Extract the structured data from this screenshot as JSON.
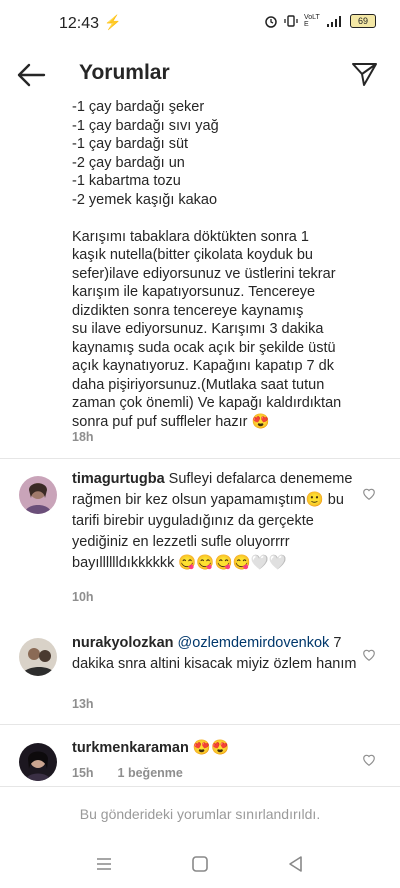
{
  "status": {
    "time": "12:43",
    "sys_icon": "⚡",
    "icons": [
      "alarm-icon",
      "vibrate-icon",
      "volte-icon",
      "signal-icon"
    ],
    "volte": "VoLTE",
    "battery": "69"
  },
  "header": {
    "title": "Yorumlar"
  },
  "caption": {
    "lines": [
      "-1 çay bardağı şeker",
      "-1 çay bardağı sıvı yağ",
      "-1 çay bardağı süt",
      "-2 çay bardağı un",
      "-1 kabartma tozu",
      "-2 yemek kaşığı kakao"
    ],
    "paragraph": [
      "Karışımı tabaklara döktükten sonra 1",
      "kaşık nutella(bitter çikolata koyduk bu",
      "sefer)ilave ediyorsunuz ve üstlerini tekrar",
      "karışım ile kapatıyorsunuz. Tencereye",
      "dizdikten sonra tencereye kaynamış",
      "su ilave ediyorsunuz. Karışımı 3 dakika",
      "kaynamış suda ocak açık bir şekilde üstü",
      "açık kaynatıyoruz. Kapağını kapatıp 7 dk",
      "daha pişiriyorsunuz.(Mutlaka saat tutun",
      "zaman çok önemli) Ve kapağı kaldırdıktan",
      "sonra puf puf suffleler hazır 😍"
    ],
    "time": "18h"
  },
  "comments": [
    {
      "username": "timagurtugba",
      "text": " Sufleyi defalarca denememe rağmen bir kez olsun yapamamıştım🙂 bu tarifi birebir uyguladığınız da gerçekte yediğiniz en lezzetli sufle oluyorrrr bayılllllldıkkkkkk 😋😋😋😋🤍🤍",
      "time": "10h",
      "likes": ""
    },
    {
      "username": "nurakyolozkan",
      "mention": " @ozlemdemirdovenkok",
      "text": " 7 dakika snra altini kisacak miyiz özlem hanım",
      "time": "13h",
      "likes": ""
    },
    {
      "username": "turkmenkaraman",
      "text": " 😍😍",
      "time": "15h",
      "likes": "1 beğenme"
    }
  ],
  "footer_note": "Bu gönderideki yorumlar sınırlandırıldı.",
  "colors": {
    "text": "#262626",
    "meta": "#8e8e8e",
    "mention": "#00376b",
    "divider": "#e6e6e6"
  }
}
